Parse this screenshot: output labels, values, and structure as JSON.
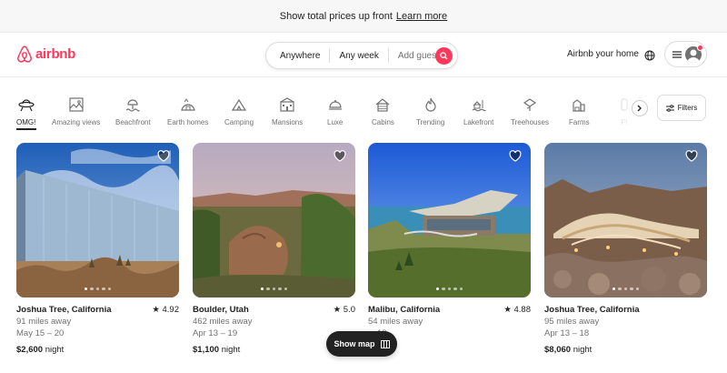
{
  "banner": {
    "text": "Show total prices up front",
    "link": "Learn more"
  },
  "header": {
    "logo": "airbnb",
    "search": {
      "where": "Anywhere",
      "when": "Any week",
      "guests": "Add guests"
    },
    "host_link": "Airbnb your home"
  },
  "colors": {
    "brand": "#ff385c",
    "text": "#222222",
    "muted": "#717171"
  },
  "categories": [
    {
      "label": "OMG!",
      "icon": "ufo-icon",
      "active": true
    },
    {
      "label": "Amazing views",
      "icon": "framed-view-icon"
    },
    {
      "label": "Beachfront",
      "icon": "beach-icon"
    },
    {
      "label": "Earth homes",
      "icon": "earth-home-icon"
    },
    {
      "label": "Camping",
      "icon": "tent-icon"
    },
    {
      "label": "Mansions",
      "icon": "mansion-icon"
    },
    {
      "label": "Luxe",
      "icon": "luxe-icon"
    },
    {
      "label": "Cabins",
      "icon": "cabin-icon"
    },
    {
      "label": "Trending",
      "icon": "flame-icon"
    },
    {
      "label": "Lakefront",
      "icon": "lake-icon"
    },
    {
      "label": "Treehouses",
      "icon": "treehouse-icon"
    },
    {
      "label": "Farms",
      "icon": "barn-icon"
    },
    {
      "label": "Pl",
      "icon": "play-icon",
      "faded": true
    }
  ],
  "filters_label": "Filters",
  "listings": [
    {
      "location": "Joshua Tree, California",
      "rating": "4.92",
      "distance": "91 miles away",
      "dates": "May 15 – 20",
      "price": "$2,600",
      "unit": "night"
    },
    {
      "location": "Boulder, Utah",
      "rating": "5.0",
      "distance": "462 miles away",
      "dates": "Apr 13 – 19",
      "price": "$1,100",
      "unit": "night"
    },
    {
      "location": "Malibu, California",
      "rating": "4.88",
      "distance": "54 miles away",
      "dates": "13",
      "price": "",
      "unit": ""
    },
    {
      "location": "Joshua Tree, California",
      "rating": "",
      "distance": "95 miles away",
      "dates": "Apr 13 – 18",
      "price": "$8,060",
      "unit": "night"
    }
  ],
  "show_map": "Show map"
}
